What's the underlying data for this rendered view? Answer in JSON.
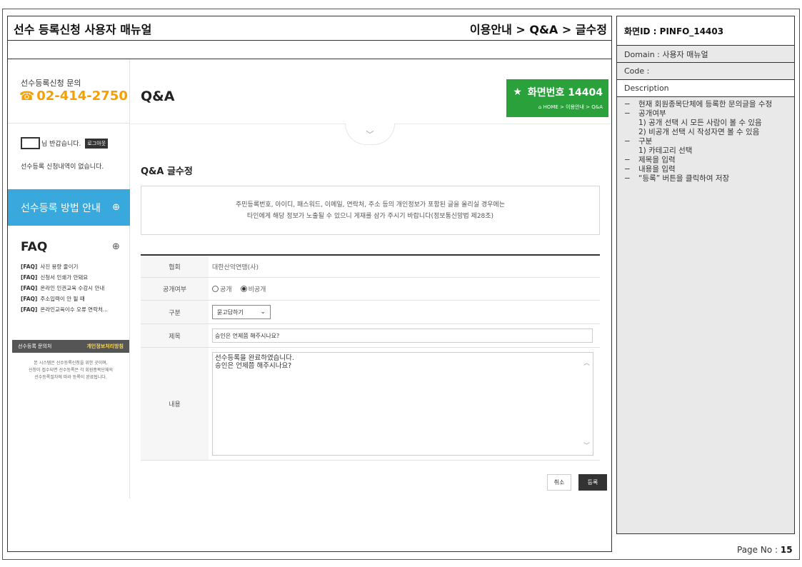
{
  "doc": {
    "title": "선수 등록신청 사용자 매뉴얼",
    "path": "이용안내 > Q&A > 글수정",
    "page_no_label": "Page No : ",
    "page_no": "15"
  },
  "sidebar": {
    "contact_title": "선수등록신청 문의",
    "phone": "02-414-2750",
    "greeting": "님 반갑습니다.",
    "logout_label": "로그아웃",
    "no_history": "선수등록 신청내역이 없습니다.",
    "guide_label": "선수등록 방법 안내",
    "faq_title": "FAQ",
    "faq_items": [
      {
        "tag": "[FAQ]",
        "text": "사진 용량 줄이기"
      },
      {
        "tag": "[FAQ]",
        "text": "신청서 인쇄가 안돼요"
      },
      {
        "tag": "[FAQ]",
        "text": "온라인 인권교육 수강시 안내"
      },
      {
        "tag": "[FAQ]",
        "text": "주소입력이 안 될 때"
      },
      {
        "tag": "[FAQ]",
        "text": "온라인교육이수 오류 연락처..."
      }
    ],
    "policy_left": "선수등록 문의처",
    "policy_right": "개인정보처리방침",
    "note_lines": [
      "본 시스템은 선수등록신청을 위한 곳이며,",
      "신청이 접수되면 선수등록은 각 회원종목단체의",
      "선수등록절차에 따라 등록이 완료됩니다."
    ]
  },
  "content": {
    "page_heading": "Q&A",
    "badge_title": "화면번호 14404",
    "badge_crumb": "HOME > 이용안내 > Q&A",
    "form_title": "Q&A 글수정",
    "notice_line1": "주민등록번호, 아이디, 패스워드, 이메일, 연락처, 주소 등의 개인정보가 포함된 글을 올리실 경우에는",
    "notice_line2": "타인에게 해당 정보가 노출될 수 있으니 게재를 삼가 주시기 바랍니다(정보통신망법 제28조)",
    "fields": {
      "org_label": "협회",
      "org_value": "대한산악연맹(사)",
      "visibility_label": "공개여부",
      "visibility_public": "공개",
      "visibility_private": "비공개",
      "visibility_selected": "비공개",
      "category_label": "구분",
      "category_value": "묻고답하기",
      "subject_label": "제목",
      "subject_value": "승인은 언제쯤 해주시나요?",
      "body_label": "내용",
      "body_line1": "선수등록을 완료하였습니다.",
      "body_line2": "승인은 언제쯤 해주시나요?"
    },
    "cancel_label": "취소",
    "submit_label": "등록"
  },
  "spec": {
    "screen_id": "화면ID : PINFO_14403",
    "domain": "Domain : 사용자 매뉴얼",
    "code": "Code :",
    "description_label": "Description",
    "items": [
      {
        "dash": "−",
        "text": "현재 회원종목단체에 등록한 문의글을 수정"
      },
      {
        "dash": "−",
        "text": "공개여부"
      },
      {
        "sub": "1) 공개 선택 시 모든 사람이 볼 수 있음"
      },
      {
        "sub": "2) 비공개 선택 시 작성자면 볼 수 있음"
      },
      {
        "dash": "−",
        "text": "구분"
      },
      {
        "sub": "1) 카테고리 선택"
      },
      {
        "dash": "−",
        "text": "제목을 입력"
      },
      {
        "dash": "−",
        "text": "내용을 입력"
      },
      {
        "dash": "−",
        "text": "“등록” 버튼을 클릭하여 저장"
      }
    ]
  },
  "colors": {
    "phone_orange": "#f5a000",
    "guide_blue": "#38a8dd",
    "badge_green": "#2aa13b",
    "privacy_yellow": "#ffd84a"
  },
  "icons": {
    "phone": "phone-icon",
    "star": "star-icon",
    "home": "home-icon",
    "chevron": "chevron-down-icon",
    "plus": "plus-circle-icon"
  }
}
